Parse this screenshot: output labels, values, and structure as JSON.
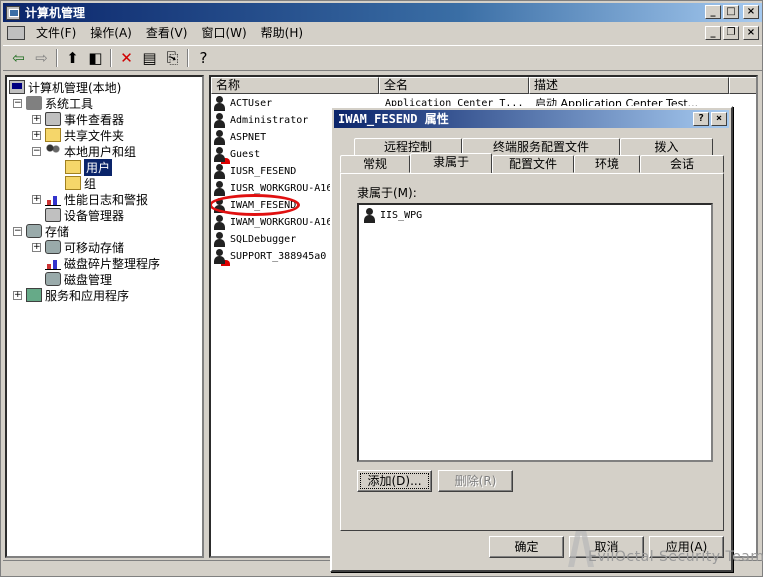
{
  "window": {
    "title": "计算机管理"
  },
  "menu": [
    "文件(F)",
    "操作(A)",
    "查看(V)",
    "窗口(W)",
    "帮助(H)"
  ],
  "tree": {
    "root": "计算机管理(本地)",
    "system_tools": "系统工具",
    "event_viewer": "事件查看器",
    "shared_folders": "共享文件夹",
    "local_users_groups": "本地用户和组",
    "users": "用户",
    "groups": "组",
    "perf_logs": "性能日志和警报",
    "device_manager": "设备管理器",
    "storage": "存储",
    "removable": "可移动存储",
    "defrag": "磁盘碎片整理程序",
    "disk_mgmt": "磁盘管理",
    "services_apps": "服务和应用程序"
  },
  "list": {
    "headers": [
      "名称",
      "全名",
      "描述"
    ],
    "rows": [
      {
        "name": "ACTUser",
        "full": "Application Center T...",
        "desc": "启动 Application Center Test..."
      },
      {
        "name": "Administrator",
        "full": "",
        "desc": ""
      },
      {
        "name": "ASPNET",
        "full": "",
        "desc": ""
      },
      {
        "name": "Guest",
        "full": "",
        "desc": ""
      },
      {
        "name": "IUSR_FESEND",
        "full": "",
        "desc": ""
      },
      {
        "name": "IUSR_WORKGROU-A16",
        "full": "",
        "desc": ""
      },
      {
        "name": "IWAM_FESEND",
        "full": "",
        "desc": ""
      },
      {
        "name": "IWAM_WORKGROU-A16",
        "full": "",
        "desc": ""
      },
      {
        "name": "SQLDebugger",
        "full": "",
        "desc": ""
      },
      {
        "name": "SUPPORT_388945a0",
        "full": "",
        "desc": ""
      }
    ]
  },
  "dialog": {
    "title": "IWAM_FESEND 属性",
    "tabs_row1": [
      "远程控制",
      "终端服务配置文件",
      "拨入"
    ],
    "tabs_row2": [
      "常规",
      "隶属于",
      "配置文件",
      "环境",
      "会话"
    ],
    "member_label": "隶属于(M):",
    "members": [
      "IIS_WPG"
    ],
    "add_button": "添加(D)...",
    "remove_button": "删除(R)",
    "ok_button": "确定",
    "cancel_button": "取消",
    "apply_button": "应用(A)"
  },
  "watermark": "EvilOctal Security Team"
}
